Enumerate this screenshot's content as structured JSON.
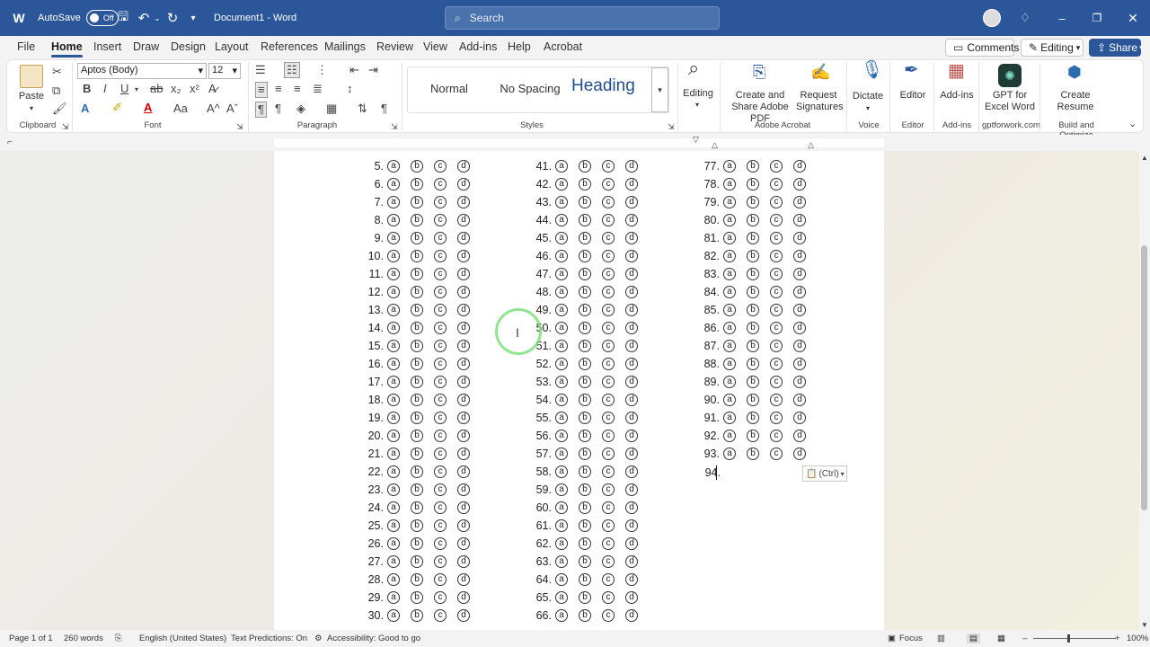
{
  "titlebar": {
    "autosave_label": "AutoSave",
    "autosave_state": "Off",
    "doc_title": "Document1 - Word",
    "search_placeholder": "Search",
    "icons": [
      "word-icon",
      "save-icon",
      "undo-icon",
      "redo-icon",
      "customize-icon",
      "lightbulb-icon",
      "minimize-icon",
      "restore-icon",
      "close-icon"
    ]
  },
  "menu": {
    "tabs": [
      "File",
      "Home",
      "Insert",
      "Draw",
      "Design",
      "Layout",
      "References",
      "Mailings",
      "Review",
      "View",
      "Add-ins",
      "Help",
      "Acrobat"
    ],
    "active": "Home",
    "comments_label": "Comments",
    "editing_label": "Editing",
    "share_label": "Share"
  },
  "ribbon": {
    "paste_label": "Paste",
    "font_name": "Aptos (Body)",
    "font_size": "12",
    "styles": {
      "normal": "Normal",
      "no_spacing": "No Spacing",
      "heading": "Heading"
    },
    "editing_label": "Editing",
    "acrobat_create": "Create and Share Adobe PDF",
    "acrobat_request": "Request Signatures",
    "dictate_label": "Dictate",
    "editor_label": "Editor",
    "addins_label": "Add-ins",
    "gpt_label": "GPT for Excel Word",
    "resume_label": "Create Resume",
    "groups": {
      "clipboard": "Clipboard",
      "font": "Font",
      "paragraph": "Paragraph",
      "styles": "Styles",
      "adobe_acrobat": "Adobe Acrobat",
      "voice": "Voice",
      "editor": "Editor",
      "addins": "Add-ins",
      "gptforwork": "gptforwork.com",
      "build_optimize": "Build and Optimize"
    }
  },
  "document": {
    "options": [
      "ⓐ",
      "ⓑ",
      "ⓒ",
      "ⓓ"
    ],
    "column1": [
      "5.",
      "6.",
      "7.",
      "8.",
      "9.",
      "10.",
      "11.",
      "12.",
      "13.",
      "14.",
      "15.",
      "16.",
      "17.",
      "18.",
      "19.",
      "20.",
      "21.",
      "22.",
      "23.",
      "24.",
      "25.",
      "26.",
      "27.",
      "28.",
      "29.",
      "30."
    ],
    "column2": [
      "41.",
      "42.",
      "43.",
      "44.",
      "45.",
      "46.",
      "47.",
      "48.",
      "49.",
      "50.",
      "51.",
      "52.",
      "53.",
      "54.",
      "55.",
      "56.",
      "57.",
      "58.",
      "59.",
      "60.",
      "61.",
      "62.",
      "63.",
      "64.",
      "65.",
      "66."
    ],
    "column3": [
      "77.",
      "78.",
      "79.",
      "80.",
      "81.",
      "82.",
      "83.",
      "84.",
      "85.",
      "86.",
      "87.",
      "88.",
      "89.",
      "90.",
      "91.",
      "92.",
      "93."
    ],
    "current_line": "94.",
    "paste_options_label": "(Ctrl)"
  },
  "status": {
    "page": "Page 1 of 1",
    "words": "260 words",
    "language": "English (United States)",
    "predictions": "Text Predictions: On",
    "accessibility": "Accessibility: Good to go",
    "focus": "Focus",
    "zoom": "100%"
  }
}
